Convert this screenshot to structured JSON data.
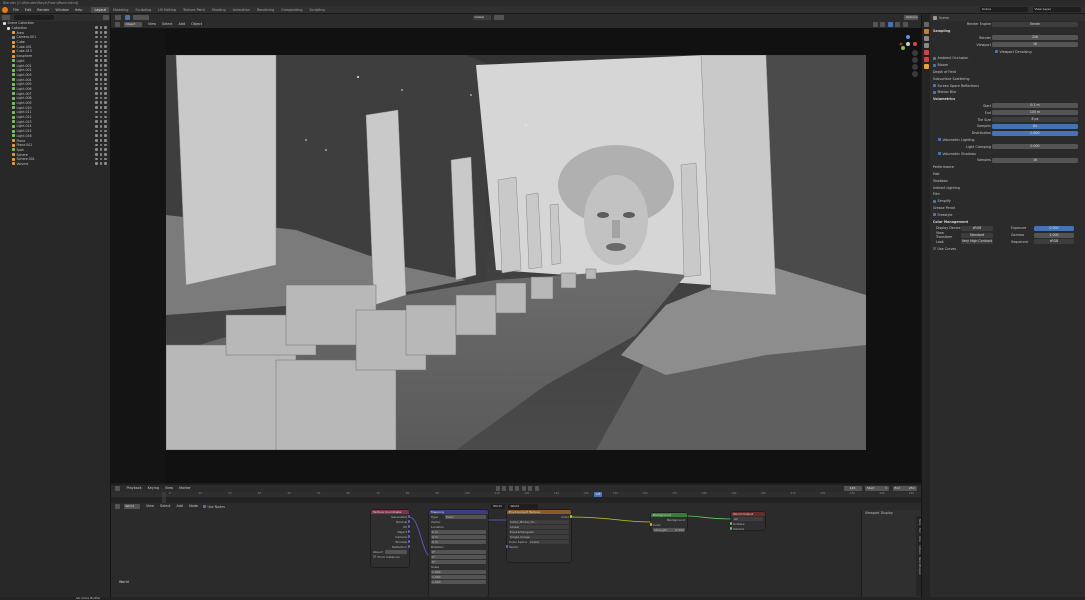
{
  "app": {
    "title": "Blender [C:\\Blender\\Maya\\Flash\\Ward.blend]"
  },
  "menubar": {
    "menus": [
      "File",
      "Edit",
      "Render",
      "Window",
      "Help"
    ],
    "workspaces": [
      "Layout",
      "Modeling",
      "Sculpting",
      "UV Editing",
      "Texture Paint",
      "Shading",
      "Animation",
      "Rendering",
      "Compositing",
      "Scripting"
    ],
    "active_workspace": "Layout",
    "scene": "Scene",
    "view_layer": "View Layer"
  },
  "outliner": {
    "root": "Scene Collection",
    "collection": "Collection",
    "items": [
      {
        "name": "Area",
        "color": "#e6a13c"
      },
      {
        "name": "Camera.001",
        "color": "#9a9a9a"
      },
      {
        "name": "Cube",
        "color": "#e6a13c"
      },
      {
        "name": "Cube.001",
        "color": "#e6a13c"
      },
      {
        "name": "Cube.013",
        "color": "#e6a13c"
      },
      {
        "name": "Icosphere",
        "color": "#e6a13c"
      },
      {
        "name": "Light",
        "color": "#7fbf6a"
      },
      {
        "name": "Light.001",
        "color": "#7fbf6a"
      },
      {
        "name": "Light.002",
        "color": "#7fbf6a"
      },
      {
        "name": "Light.003",
        "color": "#7fbf6a"
      },
      {
        "name": "Light.004",
        "color": "#7fbf6a"
      },
      {
        "name": "Light.005",
        "color": "#7fbf6a"
      },
      {
        "name": "Light.006",
        "color": "#7fbf6a"
      },
      {
        "name": "Light.007",
        "color": "#7fbf6a"
      },
      {
        "name": "Light.008",
        "color": "#7fbf6a"
      },
      {
        "name": "Light.009",
        "color": "#7fbf6a"
      },
      {
        "name": "Light.010",
        "color": "#7fbf6a"
      },
      {
        "name": "Light.011",
        "color": "#7fbf6a"
      },
      {
        "name": "Light.012",
        "color": "#7fbf6a"
      },
      {
        "name": "Light.013",
        "color": "#7fbf6a"
      },
      {
        "name": "Light.014",
        "color": "#7fbf6a"
      },
      {
        "name": "Light.015",
        "color": "#7fbf6a"
      },
      {
        "name": "Light.016",
        "color": "#7fbf6a"
      },
      {
        "name": "Plane",
        "color": "#e6a13c"
      },
      {
        "name": "Plane.001",
        "color": "#e6a13c"
      },
      {
        "name": "Spot",
        "color": "#7fbf6a"
      },
      {
        "name": "Sphere",
        "color": "#e6a13c"
      },
      {
        "name": "Sphere.001",
        "color": "#e6a13c"
      },
      {
        "name": "Volume",
        "color": "#e6a13c"
      }
    ]
  },
  "viewport": {
    "mode": "Object Mode",
    "menus": [
      "View",
      "Select",
      "Add",
      "Object"
    ],
    "transform": "Global",
    "options": "Options"
  },
  "properties": {
    "header": "Scene",
    "render_engine_label": "Render Engine",
    "render_engine": "Eevee",
    "sections": {
      "sampling": "Sampling",
      "render_label": "Render",
      "render_val": "256",
      "viewport_label": "Viewport",
      "viewport_val": "16",
      "denoise": "Viewport Denoising",
      "ao": "Ambient Occlusion",
      "bloom": "Bloom",
      "dof": "Depth of Field",
      "sss": "Subsurface Scattering",
      "ssr": "Screen Space Reflections",
      "motion_blur": "Motion Blur",
      "volumetrics": "Volumetrics",
      "start_label": "Start",
      "start_val": "0.1 m",
      "end_label": "End",
      "end_val": "100 m",
      "tile_label": "Tile Size",
      "tile_val": "8 px",
      "samples_label": "Samples",
      "samples_val": "64",
      "distribution_label": "Distribution",
      "distribution_val": "0.800",
      "vol_lighting": "Volumetric Lighting",
      "light_clamp_label": "Light Clamping",
      "light_clamp_val": "0.000",
      "vol_shadows": "Volumetric Shadows",
      "shadow_samples_label": "Samples",
      "shadow_samples_val": "16",
      "performance": "Performance",
      "hair": "Hair",
      "shadows": "Shadows",
      "indirect": "Indirect Lighting",
      "film": "Film",
      "simplify": "Simplify",
      "grease_pencil": "Grease Pencil",
      "freestyle": "Freestyle",
      "color_mgmt": "Color Management",
      "display_device_label": "Display Device",
      "display_device": "sRGB",
      "view_transform_label": "View Transform",
      "view_transform": "Standard",
      "look_label": "Look",
      "look": "Very High Contrast",
      "exposure_label": "Exposure",
      "exposure_val": "0.000",
      "gamma_label": "Gamma",
      "gamma_val": "1.000",
      "sequencer_label": "Sequencer",
      "sequencer_val": "sRGB",
      "use_curves": "Use Curves"
    }
  },
  "timeline": {
    "menus": [
      "Playback",
      "Keying",
      "View",
      "Marker"
    ],
    "current_frame": "145",
    "start_label": "Start",
    "start_val": "1",
    "end_label": "End",
    "end_val": "250",
    "ticks": [
      "0",
      "10",
      "20",
      "30",
      "40",
      "50",
      "60",
      "70",
      "80",
      "90",
      "100",
      "110",
      "120",
      "130",
      "140",
      "150",
      "160",
      "170",
      "180",
      "190",
      "200",
      "210",
      "220",
      "230",
      "240",
      "250"
    ]
  },
  "node_editor": {
    "type": "World",
    "menus": [
      "View",
      "Select",
      "Add",
      "Node"
    ],
    "use_nodes": "Use Nodes",
    "world_name": "World",
    "slot": "World",
    "bottom_label": "World",
    "texcoord": {
      "title": "Texture Coordinate",
      "outputs": [
        "Generated",
        "Normal",
        "UV",
        "Object",
        "Camera",
        "Window",
        "Reflection"
      ],
      "object_label": "Object",
      "from_instancer": "From Instancer"
    },
    "mapping": {
      "title": "Mapping",
      "type_label": "Type",
      "type_val": "Point",
      "vector_label": "Vector",
      "location": "Location",
      "rotation": "Rotation",
      "scale": "Scale",
      "loc": [
        "0 m",
        "0 m",
        "0 m"
      ],
      "rot": [
        "0°",
        "0°",
        "0°"
      ],
      "scl": [
        "1.000",
        "1.000",
        "1.000"
      ]
    },
    "envtex": {
      "title": "Environment Texture",
      "color_out": "Color",
      "image": "hdrpx_Bridal_Ch...",
      "interp": "Linear",
      "proj": "Equirectangular",
      "src": "Single Image",
      "colorspace_label": "Color Space",
      "colorspace_val": "Linear",
      "vector_in": "Vector"
    },
    "background": {
      "title": "Background",
      "out": "Background",
      "color_in": "Color",
      "strength_label": "Strength",
      "strength_val": "0.500"
    },
    "output": {
      "title": "World Output",
      "target": "All",
      "surface": "Surface",
      "volume": "Volume"
    },
    "side_panel_title": "Viewport Display",
    "side_tabs": [
      "Node",
      "Tool",
      "View",
      "Options",
      "Node Wrangler"
    ]
  },
  "statusbar": {
    "left": "Set Active Modifier"
  }
}
